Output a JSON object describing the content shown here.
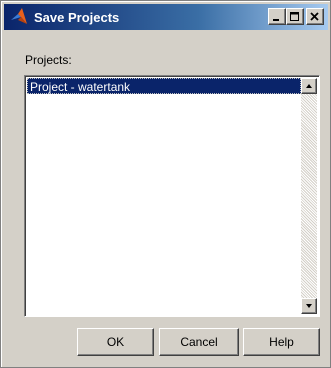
{
  "window": {
    "title": "Save Projects",
    "icons": {
      "app": "matlab-logo-icon",
      "minimize": "minimize-icon",
      "maximize": "maximize-icon",
      "close": "close-icon"
    }
  },
  "projects_label": "Projects:",
  "list": {
    "items": [
      "Project - watertank"
    ],
    "selected_index": 0
  },
  "scrollbar": {
    "up_icon": "arrow-up-icon",
    "down_icon": "arrow-down-icon"
  },
  "buttons": {
    "ok": "OK",
    "cancel": "Cancel",
    "help": "Help"
  },
  "colors": {
    "titlebar_start": "#0a246a",
    "selection": "#0a246a",
    "dialog_bg": "#d4d0c8"
  }
}
